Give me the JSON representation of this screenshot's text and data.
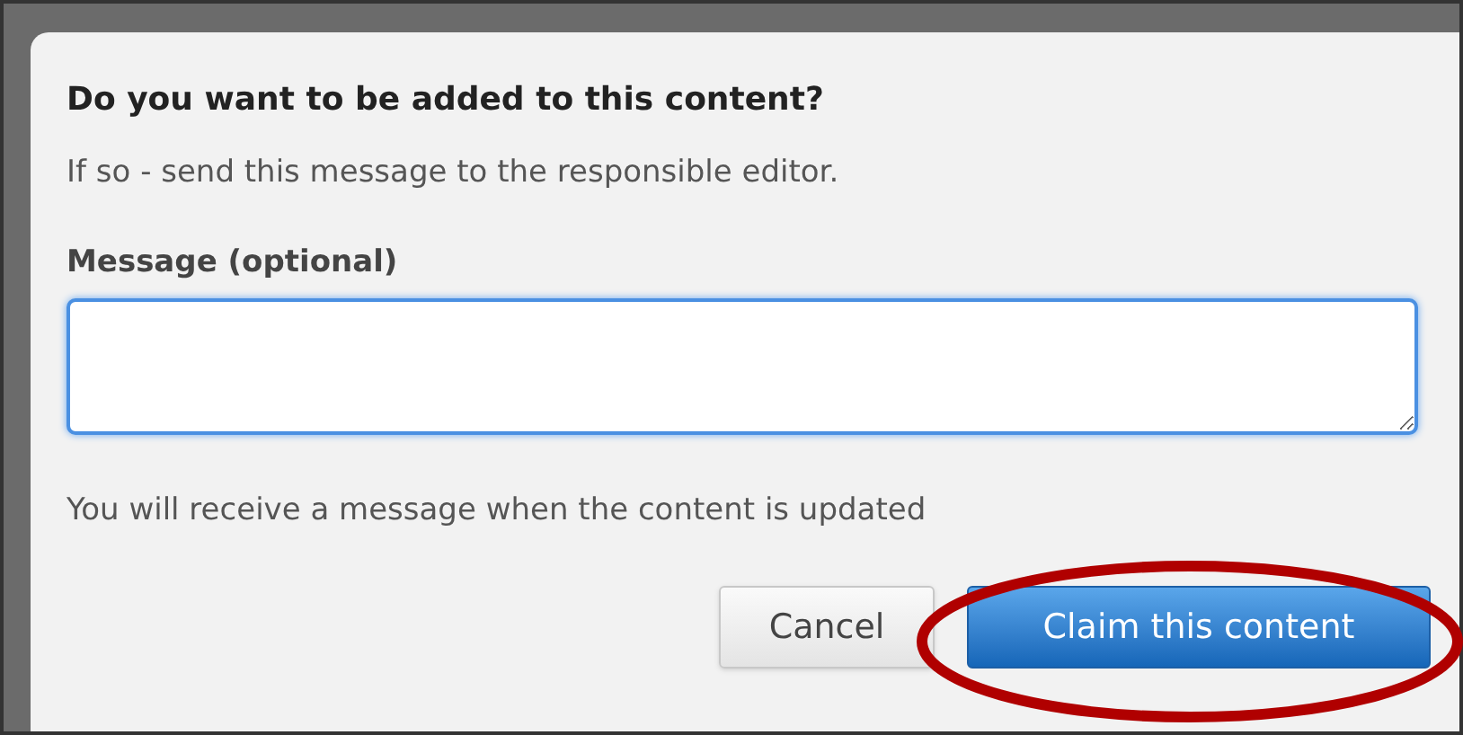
{
  "dialog": {
    "title": "Do you want to be added to this content?",
    "subtitle": "If so - send this message to the responsible editor.",
    "message_field": {
      "label": "Message (optional)",
      "focused": true
    },
    "note": "You will receive a message when the content is updated",
    "buttons": [
      {
        "label": "Cancel",
        "kind": "secondary"
      },
      {
        "label": "Claim this content",
        "kind": "primary",
        "highlighted": true
      }
    ]
  }
}
